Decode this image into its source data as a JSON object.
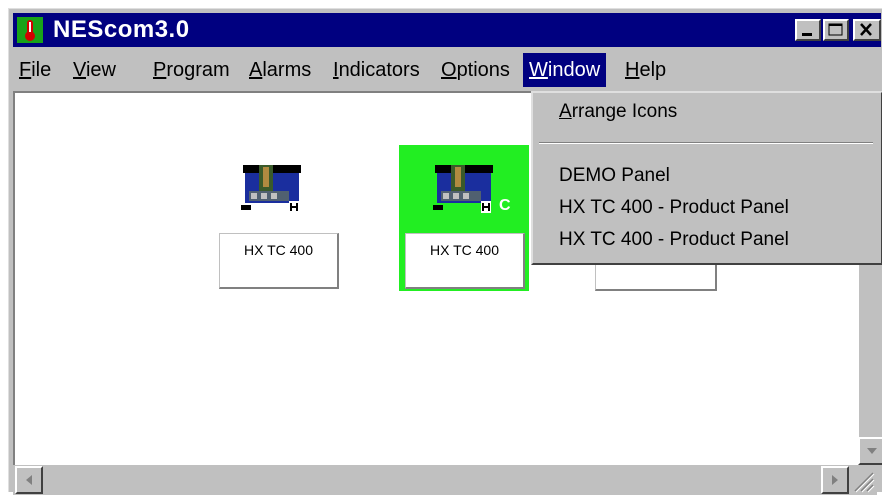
{
  "window": {
    "title": "NEScom3.0"
  },
  "menubar": {
    "items": [
      {
        "key": "F",
        "rest": "ile"
      },
      {
        "key": "V",
        "rest": "iew"
      },
      {
        "key": "P",
        "rest": "rogram"
      },
      {
        "key": "A",
        "rest": "larms"
      },
      {
        "key": "I",
        "rest": "ndicators"
      },
      {
        "key": "O",
        "rest": "ptions"
      },
      {
        "key": "W",
        "rest": "indow"
      },
      {
        "key": "H",
        "rest": "elp"
      }
    ]
  },
  "dropdown": {
    "arrange": {
      "key": "A",
      "rest": "rrange Icons"
    },
    "items": [
      "DEMO Panel",
      "HX TC 400 - Product Panel",
      "HX TC 400 - Product Panel"
    ]
  },
  "icons": [
    {
      "label": "HX TC 400",
      "badge": ""
    },
    {
      "label": "HX TC 400",
      "badge": "C"
    }
  ],
  "colors": {
    "titlebar": "#000080",
    "selected_icon_bg": "#22ee22",
    "app_icon_bg": "#19a319"
  }
}
